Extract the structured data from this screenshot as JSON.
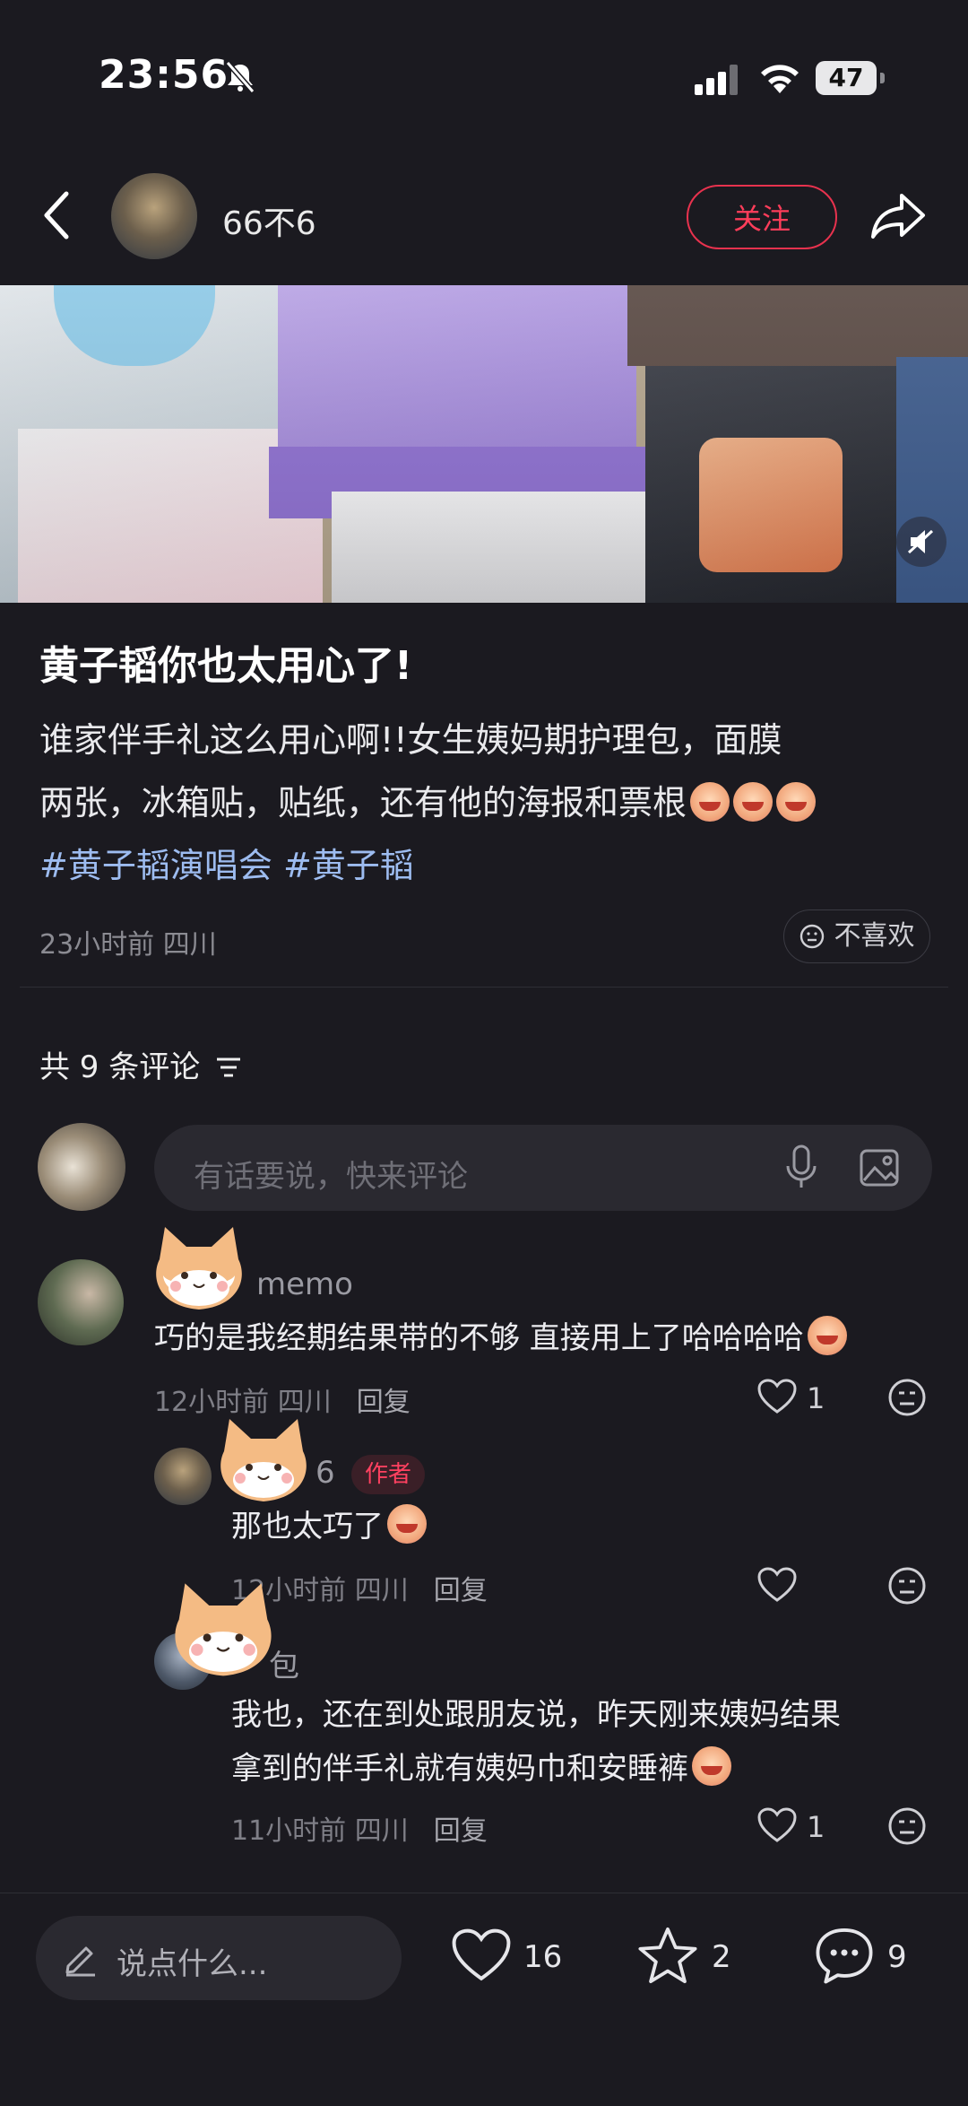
{
  "status_bar": {
    "time": "23:56",
    "battery": "47"
  },
  "header": {
    "author": "66不6",
    "follow_label": "关注"
  },
  "post": {
    "title": "黄子韬你也太用心了!",
    "body_line1": "谁家伴手礼这么用心啊!!女生姨妈期护理包，面膜",
    "body_line2": "两张，冰箱贴，贴纸，还有他的海报和票根",
    "tag1": "#黄子韬演唱会",
    "tag2": "#黄子韬",
    "time": "23小时前",
    "location": "四川",
    "dislike_label": "不喜欢"
  },
  "comments_header": {
    "count_label": "共 9 条评论"
  },
  "comment_input": {
    "placeholder": "有话要说，快来评论"
  },
  "comments": [
    {
      "name": "memo",
      "text": "巧的是我经期结果带的不够 直接用上了哈哈哈哈",
      "time": "12小时前",
      "location": "四川",
      "reply": "回复",
      "likes": "1"
    },
    {
      "name": "6",
      "badge": "作者",
      "text": "那也太巧了",
      "time": "12小时前",
      "location": "四川",
      "reply": "回复",
      "likes": ""
    },
    {
      "name": "包",
      "text_line1": "我也，还在到处跟朋友说，昨天刚来姨妈结果",
      "text_line2": "拿到的伴手礼就有姨妈巾和安睡裤",
      "time": "11小时前",
      "location": "四川",
      "reply": "回复",
      "likes": "1"
    }
  ],
  "bottom_bar": {
    "input_label": "说点什么...",
    "likes": "16",
    "stars": "2",
    "comments": "9"
  },
  "colors": {
    "background": "#1b1a20",
    "accent_red": "#ff3d5a",
    "tag_blue": "#9dbcf0"
  }
}
